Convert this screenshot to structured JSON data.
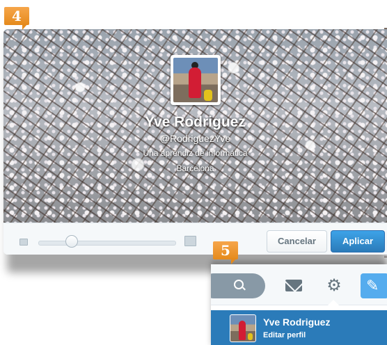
{
  "steps": {
    "step4": "4",
    "step5": "5"
  },
  "profile_editor": {
    "name": "Yve Rodriguez",
    "handle": "@RodriguezYve",
    "bio": "Una aprendiz de informática",
    "location": "Barcelona",
    "zoom_slider": {
      "value_fraction": 0.2
    },
    "cancel_label": "Cancelar",
    "apply_label": "Aplicar"
  },
  "nav": {
    "icons": [
      "search-icon",
      "mail-icon",
      "gear-icon",
      "compose-icon"
    ],
    "profile_item": {
      "name": "Yve Rodriguez",
      "subtitle": "Editar perfil"
    },
    "accent_color": "#2b7bb9"
  }
}
